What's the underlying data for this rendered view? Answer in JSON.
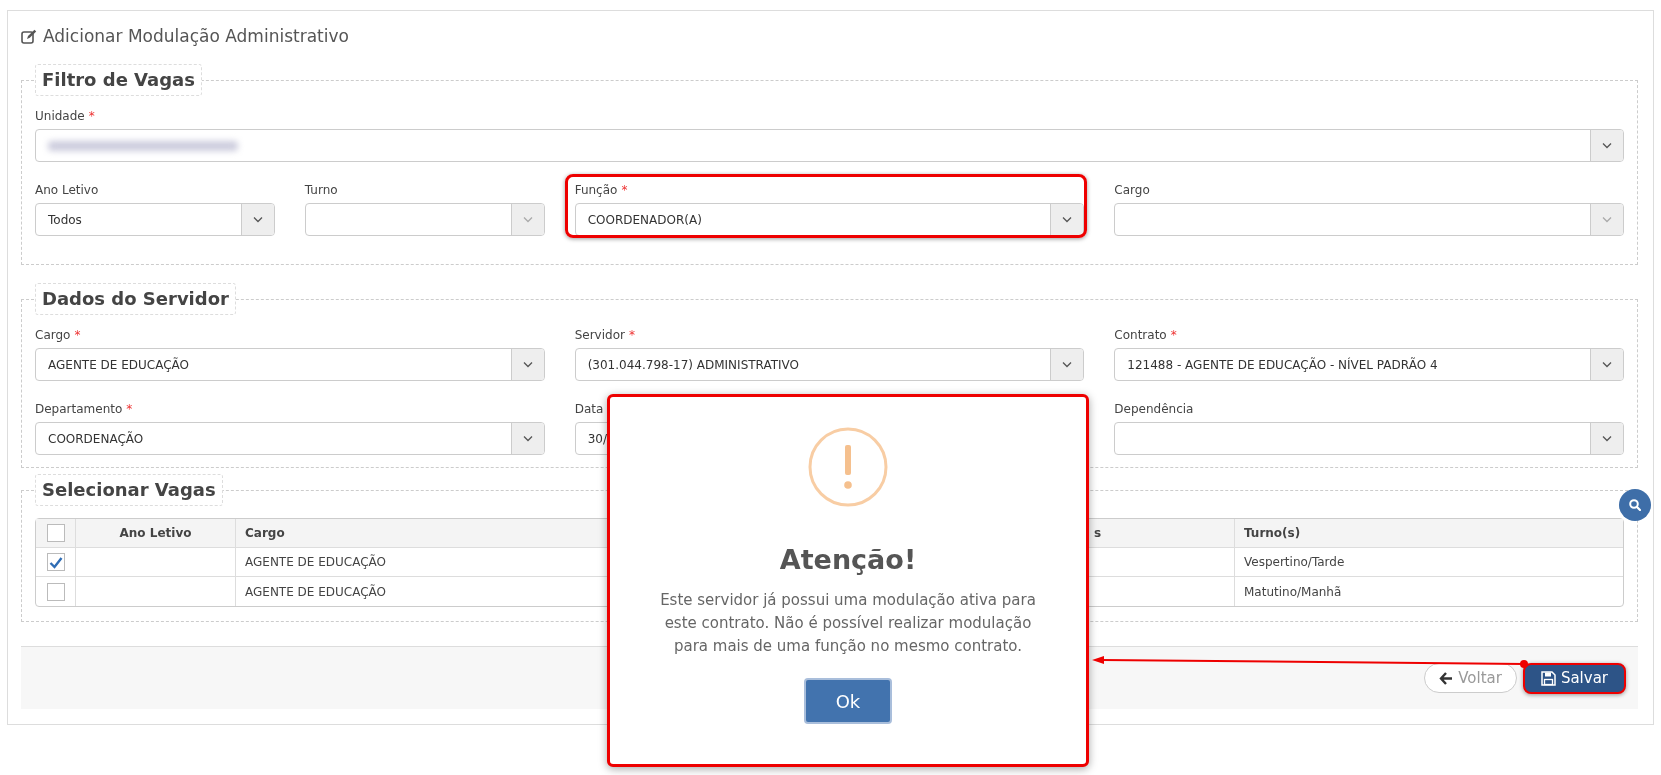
{
  "page_title": "Adicionar Modulação Administrativo",
  "filter": {
    "legend": "Filtro de Vagas",
    "unidade": {
      "label": "Unidade",
      "required_mark": "*",
      "blurred": true
    },
    "fields": [
      {
        "label": "Ano Letivo",
        "value": "Todos",
        "disabled": false,
        "highlighted": false
      },
      {
        "label": "Turno",
        "disabled": true,
        "highlighted": false
      },
      {
        "label": "Função",
        "required_mark": "*",
        "value": "COORDENADOR(A)",
        "disabled": false,
        "highlighted": true
      },
      {
        "label": "Cargo",
        "disabled": true,
        "highlighted": false
      }
    ]
  },
  "servidor": {
    "legend": "Dados do Servidor",
    "fields": [
      {
        "label": "Cargo",
        "required_mark": "*",
        "value": "AGENTE DE EDUCAÇÃO",
        "kind": "select"
      },
      {
        "label": "Servidor",
        "required_mark": "*",
        "value": "(301.044.798-17) ADMINISTRATIVO",
        "kind": "select"
      },
      {
        "label": "Contrato",
        "required_mark": "*",
        "value": "121488 - AGENTE DE EDUCAÇÃO - NÍVEL PADRÃO 4",
        "kind": "select"
      },
      {
        "label": "Departamento",
        "required_mark": "*",
        "value": "COORDENAÇÃO",
        "kind": "select"
      },
      {
        "label": "Data",
        "value": "30/",
        "kind": "text"
      },
      {
        "label": "Dependência",
        "kind": "select"
      }
    ]
  },
  "vagas": {
    "legend": "Selecionar Vagas",
    "select_all_checked": false,
    "columns": [
      "Ano Letivo",
      "Cargo",
      "s",
      "Turno(s)"
    ],
    "rows": [
      {
        "checked": true,
        "cargo": "AGENTE DE EDUCAÇÃO",
        "turnos": "Vespertino/Tarde"
      },
      {
        "checked": false,
        "cargo": "AGENTE DE EDUCAÇÃO",
        "turnos": "Matutino/Manhã"
      }
    ]
  },
  "buttons": [
    {
      "label": "Voltar",
      "kind": "back",
      "highlighted": false
    },
    {
      "label": "Salvar",
      "kind": "save",
      "highlighted": true
    }
  ],
  "dialog": {
    "title": "Atenção!",
    "message": "Este servidor já possui uma modulação ativa para este contrato. Não é possível realizar modulação para mais de uma função no mesmo contrato.",
    "button": "Ok",
    "highlighted": true
  }
}
